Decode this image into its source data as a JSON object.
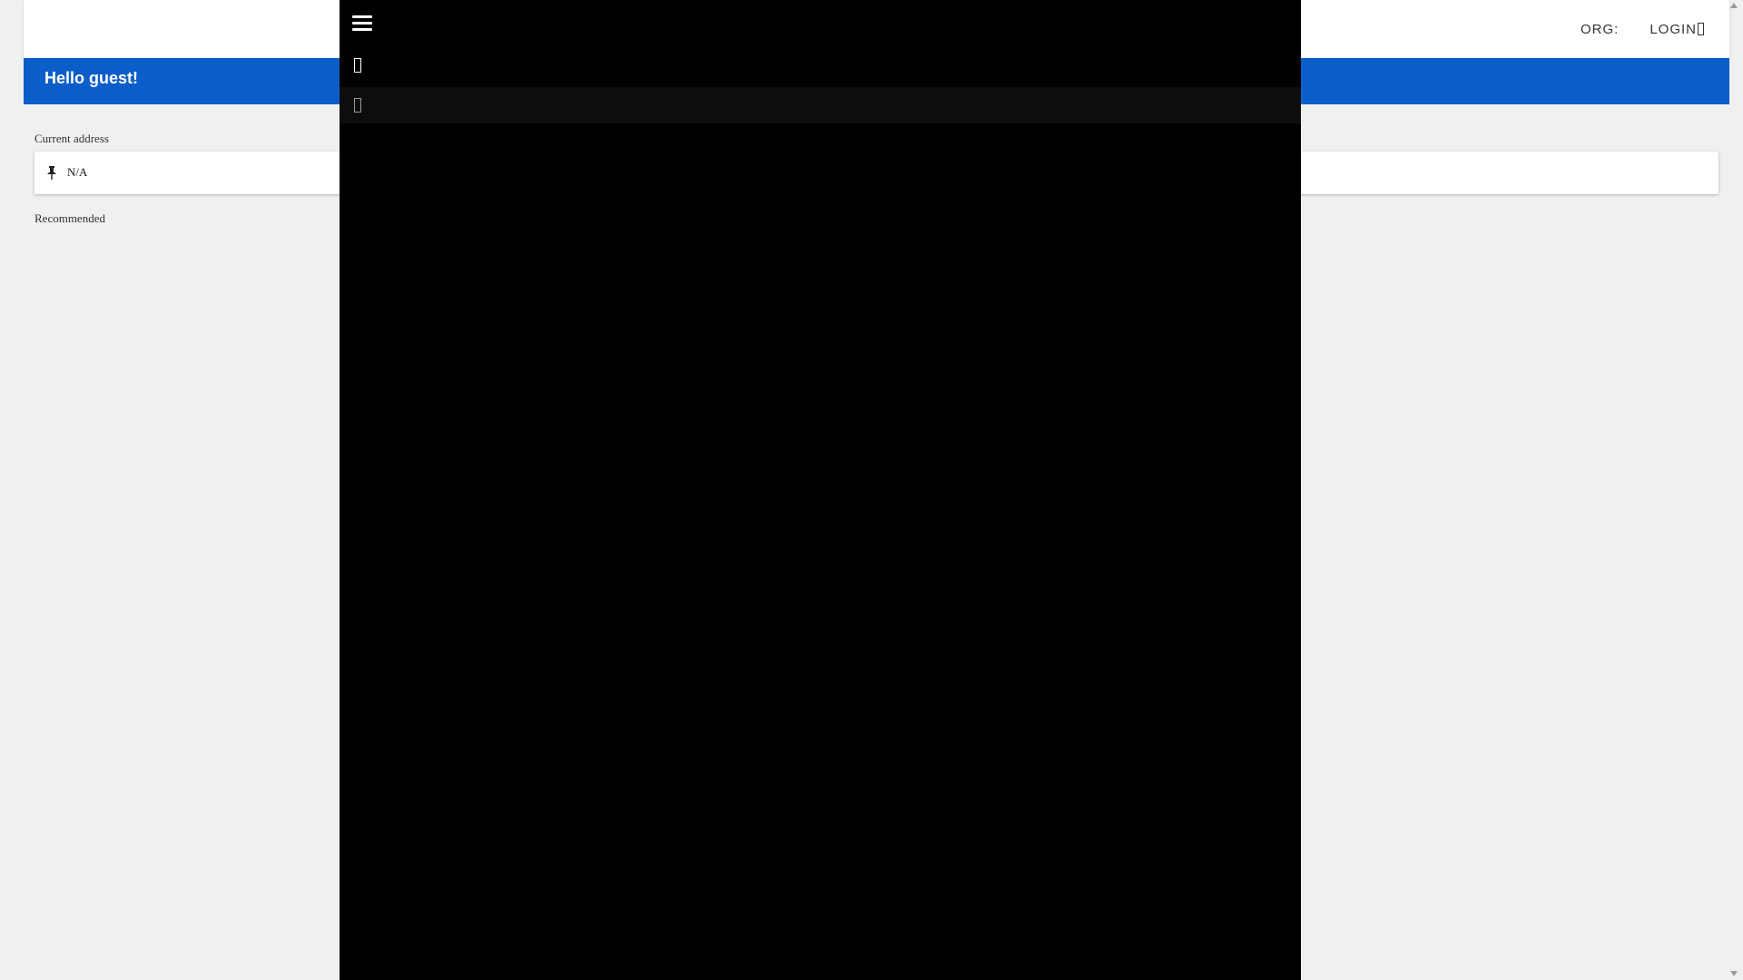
{
  "header": {
    "org_label": "ORG:",
    "login_label": "LOGIN",
    "login_icon": "login-icon"
  },
  "greeting": {
    "text": "Hello guest!",
    "color": "#0b5ec9"
  },
  "address": {
    "label": "Current address",
    "value": "N/A",
    "icon": "pin-icon"
  },
  "recommended": {
    "label": "Recommended"
  },
  "overlay": {
    "menu_icon": "hamburger-menu-icon",
    "items": [
      {
        "icon": "panel-item-icon"
      },
      {
        "icon": "panel-item-icon"
      }
    ],
    "background": "#000000"
  }
}
